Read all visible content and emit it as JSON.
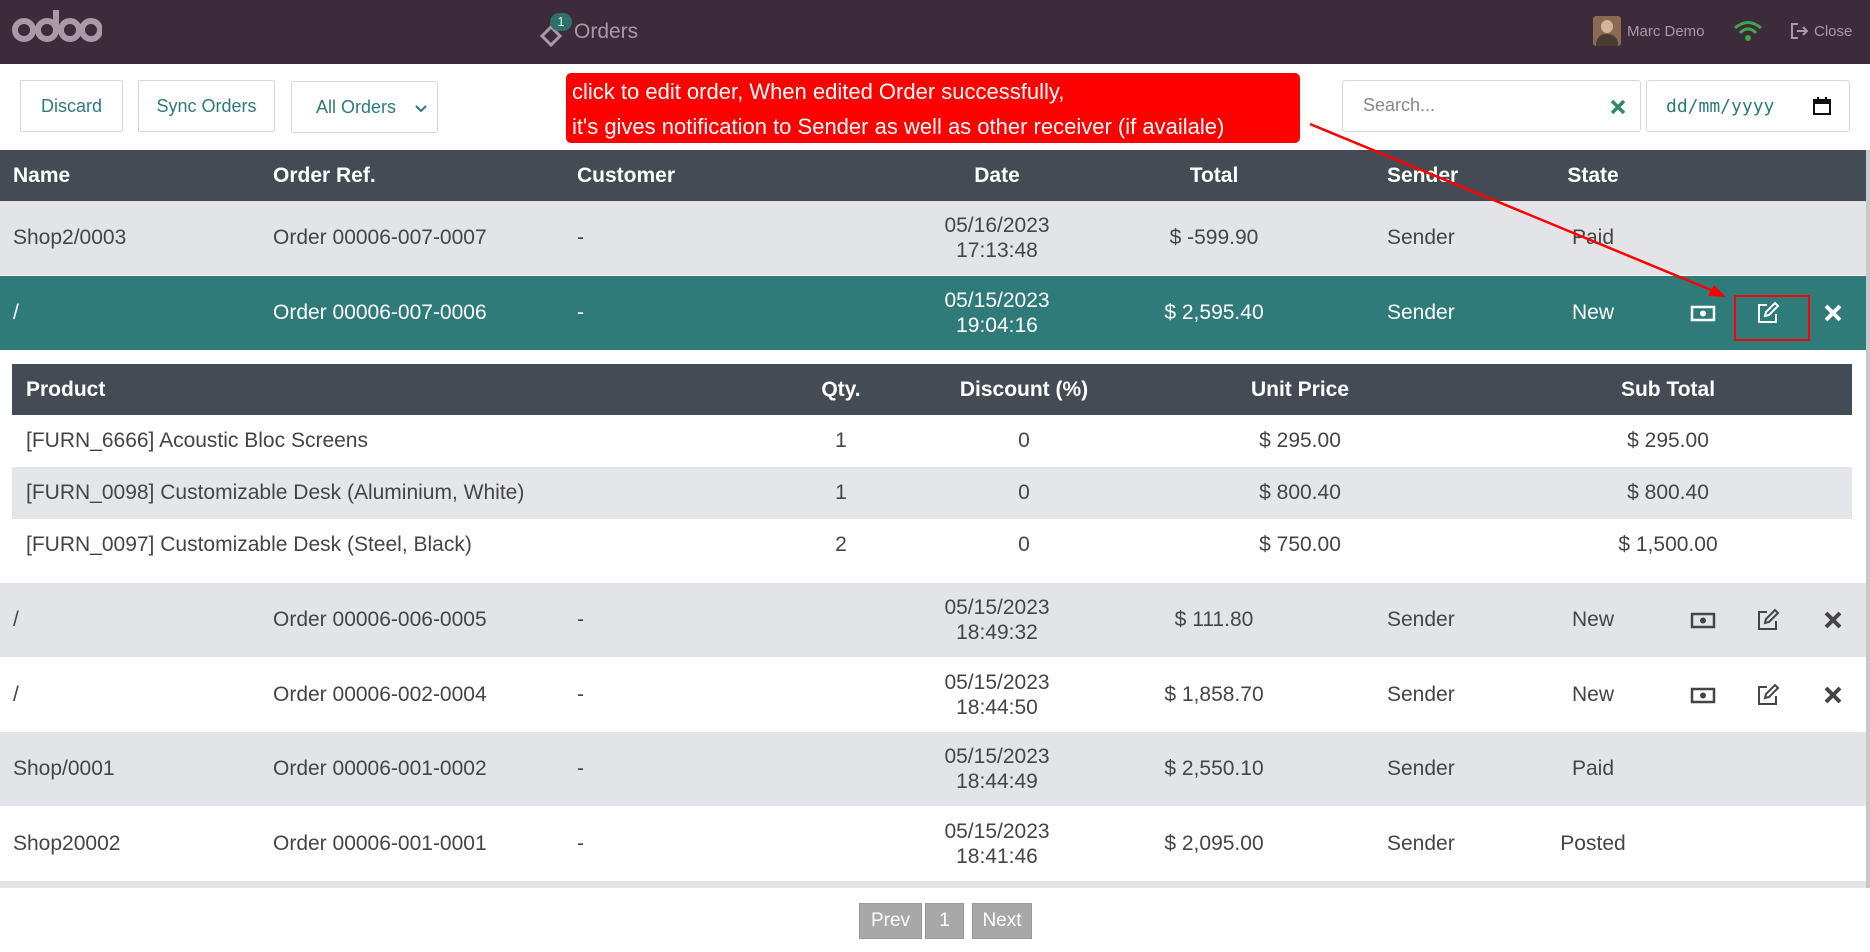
{
  "topbar": {
    "logo": "odoo",
    "title": "Orders",
    "cart_badge": "1",
    "user_name": "Marc Demo",
    "close_label": "Close"
  },
  "toolbar": {
    "discard_label": "Discard",
    "sync_label": "Sync Orders",
    "filter_value": "All Orders",
    "search_placeholder": "Search...",
    "date_placeholder": "dd/mm/yyyy"
  },
  "annotation": {
    "line1": "click to edit order, When edited Order successfully,",
    "line2": "it's gives notification to Sender as well as other receiver (if availale)"
  },
  "table": {
    "headers": [
      "Name",
      "Order Ref.",
      "Customer",
      "Date",
      "Total",
      "Sender",
      "State"
    ],
    "rows": [
      {
        "name": "Shop2/0003",
        "ref": "Order 00006-007-0007",
        "customer": "-",
        "date": "05/16/2023",
        "time": "17:13:48",
        "total": "$ -599.90",
        "sender": "Sender",
        "state": "Paid"
      },
      {
        "name": "/",
        "ref": "Order 00006-007-0006",
        "customer": "-",
        "date": "05/15/2023",
        "time": "19:04:16",
        "total": "$ 2,595.40",
        "sender": "Sender",
        "state": "New"
      },
      {
        "name": "/",
        "ref": "Order 00006-006-0005",
        "customer": "-",
        "date": "05/15/2023",
        "time": "18:49:32",
        "total": "$ 111.80",
        "sender": "Sender",
        "state": "New"
      },
      {
        "name": "/",
        "ref": "Order 00006-002-0004",
        "customer": "-",
        "date": "05/15/2023",
        "time": "18:44:50",
        "total": "$ 1,858.70",
        "sender": "Sender",
        "state": "New"
      },
      {
        "name": "Shop/0001",
        "ref": "Order 00006-001-0002",
        "customer": "-",
        "date": "05/15/2023",
        "time": "18:44:49",
        "total": "$ 2,550.10",
        "sender": "Sender",
        "state": "Paid"
      },
      {
        "name": "Shop20002",
        "ref": "Order 00006-001-0001",
        "customer": "-",
        "date": "05/15/2023",
        "time": "18:41:46",
        "total": "$ 2,095.00",
        "sender": "Sender",
        "state": "Posted"
      }
    ]
  },
  "detail": {
    "headers": [
      "Product",
      "Qty.",
      "Discount (%)",
      "Unit Price",
      "Sub Total"
    ],
    "lines": [
      {
        "product": "[FURN_6666] Acoustic Bloc Screens",
        "qty": "1",
        "discount": "0",
        "unit_price": "$ 295.00",
        "subtotal": "$ 295.00"
      },
      {
        "product": "[FURN_0098] Customizable Desk (Aluminium, White)",
        "qty": "1",
        "discount": "0",
        "unit_price": "$ 800.40",
        "subtotal": "$ 800.40"
      },
      {
        "product": "[FURN_0097] Customizable Desk (Steel, Black)",
        "qty": "2",
        "discount": "0",
        "unit_price": "$ 750.00",
        "subtotal": "$ 1,500.00"
      }
    ]
  },
  "pager": {
    "prev_label": "Prev",
    "page": "1",
    "next_label": "Next"
  },
  "colors": {
    "topbar": "#3d2a3a",
    "accent": "#2f7b7a",
    "header": "#454b55",
    "annotation": "#ff0000"
  },
  "icons": [
    "cart-icon",
    "wifi-icon",
    "sign-out-icon",
    "clear-search-icon",
    "calendar-icon",
    "money-icon",
    "edit-icon",
    "delete-icon",
    "chevron-down-icon"
  ]
}
